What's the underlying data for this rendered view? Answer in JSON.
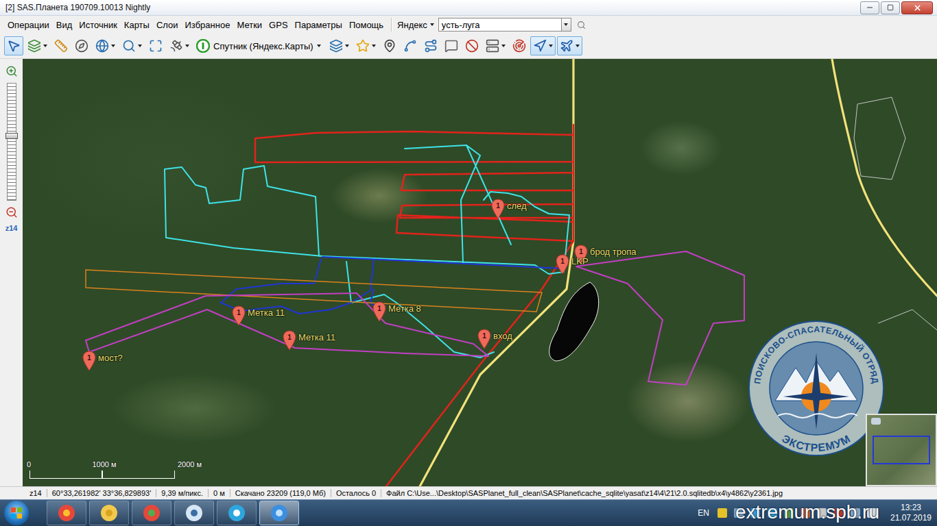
{
  "window": {
    "title": "[2] SAS.Планета 190709.10013 Nightly"
  },
  "menu": [
    "Операции",
    "Вид",
    "Источник",
    "Карты",
    "Слои",
    "Избранное",
    "Метки",
    "GPS",
    "Параметры",
    "Помощь"
  ],
  "search": {
    "engine": "Яндекс",
    "value": "усть-луга"
  },
  "toolbar": {
    "tools_left": [
      {
        "kind": "plain",
        "pressed": true
      },
      {
        "kind": "split",
        "pressed": false
      },
      {
        "kind": "plain",
        "pressed": false
      },
      {
        "kind": "plain",
        "pressed": false
      },
      {
        "kind": "split",
        "pressed": false
      },
      {
        "kind": "split",
        "pressed": false
      },
      {
        "kind": "plain",
        "pressed": false
      },
      {
        "kind": "split",
        "pressed": false
      }
    ],
    "map_source": "Спутник (Яндекс.Карты)",
    "tools_right": [
      {
        "kind": "split",
        "pressed": false
      },
      {
        "kind": "split",
        "pressed": false
      },
      {
        "kind": "plain",
        "pressed": false
      },
      {
        "kind": "plain",
        "pressed": false
      },
      {
        "kind": "plain",
        "pressed": false
      },
      {
        "kind": "plain",
        "pressed": false
      },
      {
        "kind": "plain",
        "pressed": false
      },
      {
        "kind": "split",
        "pressed": false
      },
      {
        "kind": "plain",
        "pressed": false
      },
      {
        "kind": "split",
        "pressed": true
      },
      {
        "kind": "split",
        "pressed": true
      }
    ]
  },
  "zoom": {
    "label": "z14",
    "level": 0.56
  },
  "tracks": [
    {
      "color": "#f2e27a"
    },
    {
      "color": "#e3231b"
    },
    {
      "color": "#3fe3e8"
    },
    {
      "color": "#1f36d6"
    },
    {
      "color": "#d9821e"
    },
    {
      "color": "#c23fc4"
    }
  ],
  "pins": [
    {
      "badge": "1",
      "label": "след"
    },
    {
      "badge": "1",
      "label": "брод тропа"
    },
    {
      "badge": "1",
      "label": "LKP"
    },
    {
      "badge": "1",
      "label": "Метка 11"
    },
    {
      "badge": "1",
      "label": "Метка 8"
    },
    {
      "badge": "1",
      "label": "Метка 11"
    },
    {
      "badge": "1",
      "label": "вход"
    },
    {
      "badge": "1",
      "label": "мост?"
    }
  ],
  "scale": [
    "0",
    "1000 м",
    "2000 м"
  ],
  "logo": {
    "top": "ПОИСКОВО-СПАСАТЕЛЬНЫЙ ОТРЯД",
    "bottom": "ЭКСТРЕМУМ"
  },
  "watermark": "extremum.spb.ru",
  "status_bar": [
    "z14",
    "60°33,261982' 33°36,829893'",
    "9,39 м/пикс.",
    "0 м",
    "Скачано 23209 (119,0 Мб)",
    "Осталось 0",
    "Файл C:\\Use...\\Desktop\\SASPlanet_full_clean\\SASPlanet\\cache_sqlite\\yasat\\z14\\4\\21\\2.0.sqlitedb\\x4\\y4862\\y2361.jpg"
  ],
  "taskbar": {
    "apps": [
      {
        "selected": false
      },
      {
        "selected": false
      },
      {
        "selected": false
      },
      {
        "selected": false
      },
      {
        "selected": false
      },
      {
        "selected": true
      }
    ],
    "language": "EN",
    "time": "13:23",
    "date": "21.07.2019"
  }
}
